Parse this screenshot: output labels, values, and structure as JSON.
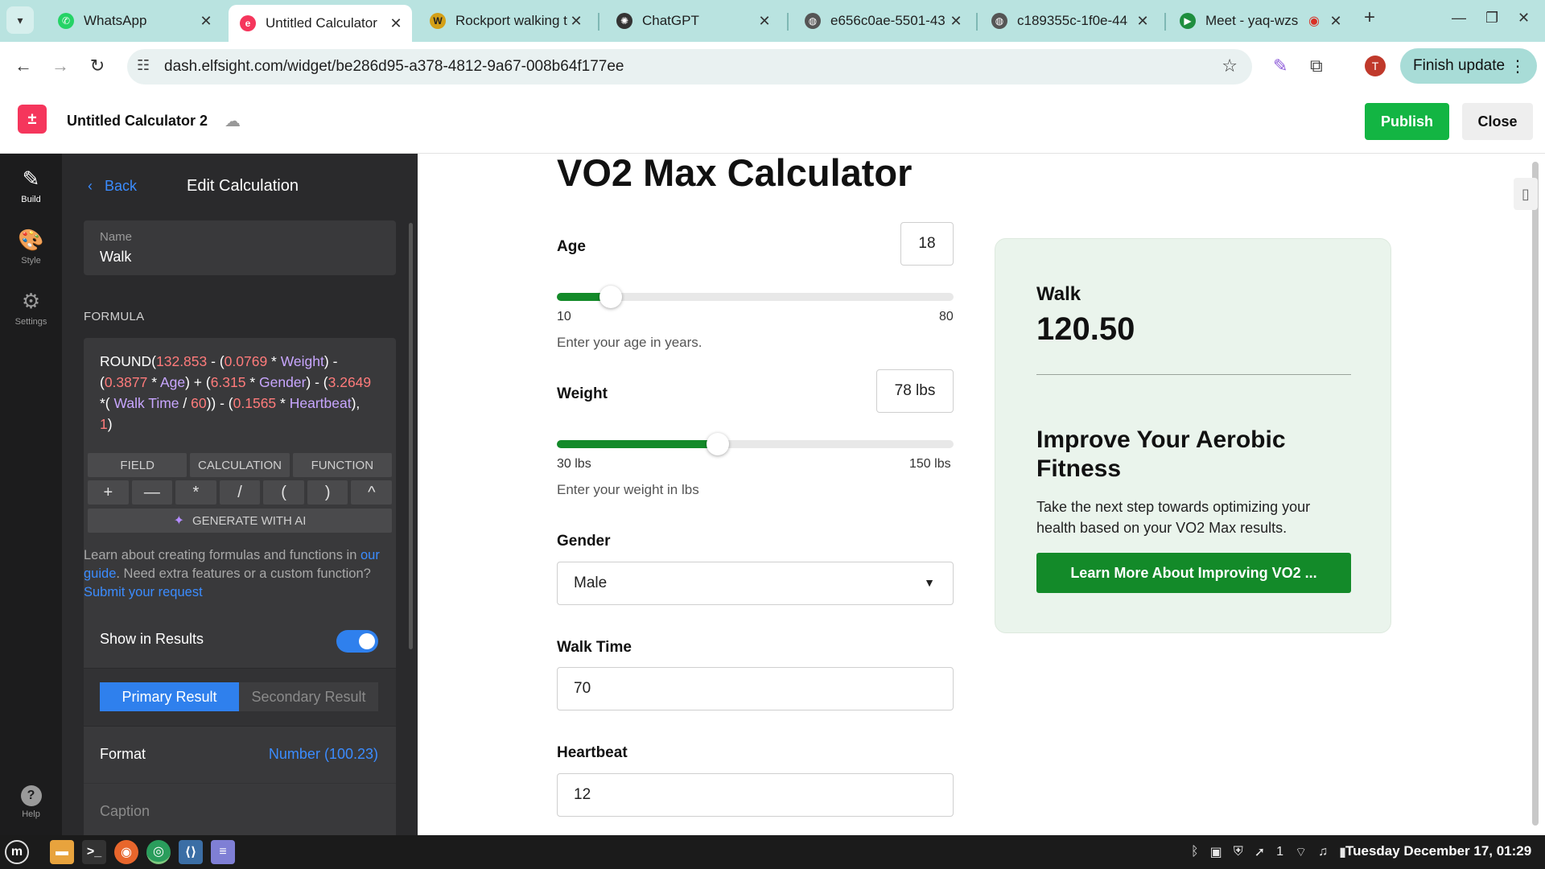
{
  "browser": {
    "tabs": [
      {
        "title": "WhatsApp",
        "icon": "whatsapp-icon"
      },
      {
        "title": "Untitled Calculator",
        "icon": "elfsight-icon",
        "active": true
      },
      {
        "title": "Rockport walking t",
        "icon": "w-icon"
      },
      {
        "title": "ChatGPT",
        "icon": "chatgpt-icon"
      },
      {
        "title": "e656c0ae-5501-43",
        "icon": "globe-icon"
      },
      {
        "title": "c189355c-1f0e-44",
        "icon": "globe-icon"
      },
      {
        "title": "Meet - yaq-wzs",
        "icon": "meet-icon"
      }
    ],
    "new_tab": "+",
    "url": "dash.elfsight.com/widget/be286d95-a378-4812-9a67-008b64f177ee",
    "profile_initial": "T",
    "finish_update": "Finish update"
  },
  "app": {
    "title": "Untitled Calculator 2",
    "publish": "Publish",
    "close": "Close"
  },
  "rail": {
    "build": "Build",
    "style": "Style",
    "settings": "Settings",
    "help": "Help"
  },
  "panel": {
    "back": "Back",
    "title": "Edit Calculation",
    "name_label": "Name",
    "name_value": "Walk",
    "formula_label": "FORMULA",
    "tabs": [
      "FIELD",
      "CALCULATION",
      "FUNCTION"
    ],
    "ops": [
      "+",
      "—",
      "*",
      "/",
      "(",
      ")",
      "^"
    ],
    "generate_ai": "GENERATE WITH AI",
    "help_prefix": "Learn about creating formulas and functions in ",
    "help_link1": "our guide",
    "help_mid": ". Need extra features or a custom function? ",
    "help_link2": "Submit your request",
    "show_in_results": "Show in Results",
    "primary_result": "Primary Result",
    "secondary_result": "Secondary Result",
    "format_label": "Format",
    "format_value": "Number (100.23)",
    "caption_label": "Caption"
  },
  "formula": {
    "f1": "ROUND(",
    "n1": "132.853",
    "t1": " - (",
    "n2": "0.0769",
    "t2": " * ",
    "v1": "Weight",
    "t3": ") - (",
    "n3": "0.3877",
    "t4": " * ",
    "v2": "Age",
    "t5": ") + (",
    "n4": "6.315",
    "t6": " *  ",
    "v3": "Gender",
    "t7": ") - (",
    "n5": "3.2649",
    "t8": " *( ",
    "v4": "Walk Time",
    "t9": " / ",
    "n6": "60",
    "t10": ")) - (",
    "n7": "0.1565",
    "t11": " * ",
    "v5": "Heartbeat",
    "t12": "), ",
    "n8": "1",
    "t13": ")"
  },
  "calculator": {
    "title": "VO2 Max Calculator",
    "age": {
      "label": "Age",
      "value": "18",
      "min_label": "10",
      "max_label": "80",
      "hint": "Enter your age in years.",
      "min": 10,
      "max": 80,
      "current": 18
    },
    "weight": {
      "label": "Weight",
      "value": "78 lbs",
      "min_label": "30 lbs",
      "max_label": "150 lbs",
      "hint": "Enter your weight in lbs",
      "min": 30,
      "max": 150,
      "current": 78
    },
    "gender": {
      "label": "Gender",
      "value": "Male"
    },
    "walk_time": {
      "label": "Walk Time",
      "value": "70"
    },
    "heartbeat": {
      "label": "Heartbeat",
      "value": "12"
    }
  },
  "result": {
    "label": "Walk",
    "value": "120.50",
    "cta_title": "Improve Your Aerobic Fitness",
    "cta_text": "Take the next step towards optimizing your health based on your VO2 Max results.",
    "cta_button": "Learn More About Improving VO2 ..."
  },
  "taskbar": {
    "clock": "Tuesday December 17, 01:29",
    "tray_badge": "1"
  },
  "colors": {
    "accent_green": "#138a29",
    "publish_green": "#13b543",
    "link_blue": "#3b8cff",
    "toggle_blue": "#2f80ed",
    "result_bg": "#eaf4ec"
  }
}
